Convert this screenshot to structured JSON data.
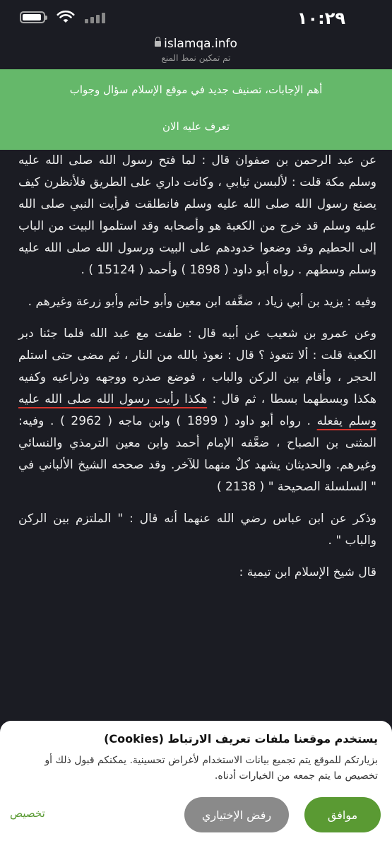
{
  "status": {
    "time": "١٠:٢٩"
  },
  "browser": {
    "url": "islamqa.info",
    "subtitle": "تم تمكين نمط المنع"
  },
  "banner": {
    "text": "أهم الإجابات، تصنيف جديد في موقع الإسلام سؤال وجواب",
    "link": "تعرف عليه الان"
  },
  "article": {
    "p1": "عن عبد الرحمن بن صفوان قال : لما فتح رسول الله صلى الله عليه وسلم مكة قلت : لألبسن ثيابي ، وكانت داري على الطريق فلأنظرن كيف يصنع رسول الله صلى الله عليه وسلم فانطلقت فرأيت النبي صلى الله عليه وسلم قد خرج من الكعبة هو وأصحابه وقد استلموا البيت من الباب إلى الحطيم وقد وضعوا خدودهم على البيت ورسول الله صلى الله عليه وسلم وسطهم . رواه أبو داود ( 1898 ) وأحمد ( 15124 ) .",
    "p2": "وفيه : يزيد بن أبي زياد ، ضعَّفه ابن معين وأبو حاتم وأبو زرعة وغيرهم .",
    "p3_start": "وعن عمرو بن شعيب عن أبيه قال : طفت مع عبد الله فلما جئنا دبر الكعبة قلت : ألا تتعوذ ؟ قال : نعوذ بالله من النار ، ثم مضى حتى استلم الحجر ، وأقام بين الركن والباب ، فوضع صدره ووجهه وذراعيه وكفيه هكذا وبسطهما بسطا ، ثم قال : ",
    "p3_highlight": "هكذا رأيت رسول الله صلى الله عليه وسلم يفعله",
    "p3_end": " . رواه أبو داود ( 1899 ) وابن ماجه ( 2962 ) . وفيه: المثنى بن الصباح ، ضعَّفه الإمام أحمد وابن معين الترمذي والنسائي وغيرهم. والحديثان يشهد كلٌ منهما للآخر. وقد صححه الشيخ الألباني في \" السلسلة الصحيحة \" ( 2138 )",
    "p4": "وذكر عن ابن عباس رضي الله عنهما أنه قال : \" الملتزم بين الركن والباب \" .",
    "p5": "قال شيخ الإسلام ابن تيمية :"
  },
  "cookie": {
    "title": "يستخدم موقعنا ملفات تعريف الارتباط (Cookies)",
    "text": "بزيارتكم للموقع يتم تجميع بيانات الاستخدام لأغراض تحسينية. يمكنكم قبول ذلك أو تخصيص ما يتم جمعه من الخيارات أدناه.",
    "accept": "موافق",
    "reject": "رفض الإختياري",
    "customize": "تخصيص"
  }
}
